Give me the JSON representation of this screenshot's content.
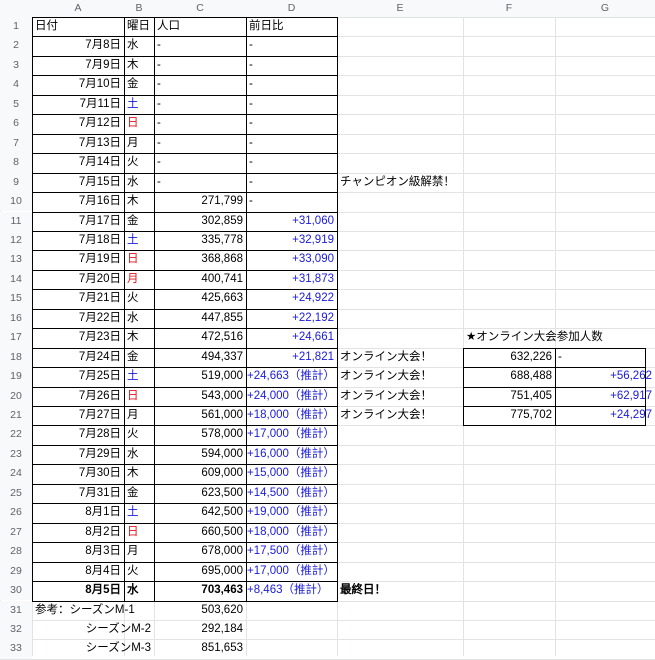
{
  "columns": [
    "A",
    "B",
    "C",
    "D",
    "E",
    "F",
    "G"
  ],
  "row_numbers": [
    "1",
    "2",
    "3",
    "4",
    "5",
    "6",
    "7",
    "8",
    "9",
    "10",
    "11",
    "12",
    "13",
    "14",
    "15",
    "16",
    "17",
    "18",
    "19",
    "20",
    "21",
    "22",
    "23",
    "24",
    "25",
    "26",
    "27",
    "28",
    "29",
    "30",
    "31",
    "32",
    "33"
  ],
  "header": {
    "date": "日付",
    "weekday": "曜日",
    "population": "人口",
    "prev_day": "前日比"
  },
  "rows": [
    {
      "date": "7月8日",
      "wd": "水",
      "wdc": "k",
      "pop": "-",
      "diff": "-"
    },
    {
      "date": "7月9日",
      "wd": "木",
      "wdc": "k",
      "pop": "-",
      "diff": "-"
    },
    {
      "date": "7月10日",
      "wd": "金",
      "wdc": "k",
      "pop": "-",
      "diff": "-"
    },
    {
      "date": "7月11日",
      "wd": "土",
      "wdc": "b",
      "pop": "-",
      "diff": "-"
    },
    {
      "date": "7月12日",
      "wd": "日",
      "wdc": "r",
      "pop": "-",
      "diff": "-"
    },
    {
      "date": "7月13日",
      "wd": "月",
      "wdc": "k",
      "pop": "-",
      "diff": "-"
    },
    {
      "date": "7月14日",
      "wd": "火",
      "wdc": "k",
      "pop": "-",
      "diff": "-"
    },
    {
      "date": "7月15日",
      "wd": "水",
      "wdc": "k",
      "pop": "-",
      "diff": "-",
      "note": "チャンピオン級解禁！"
    },
    {
      "date": "7月16日",
      "wd": "木",
      "wdc": "k",
      "pop": "271,799",
      "diff": "-"
    },
    {
      "date": "7月17日",
      "wd": "金",
      "wdc": "k",
      "pop": "302,859",
      "diff": "+31,060"
    },
    {
      "date": "7月18日",
      "wd": "土",
      "wdc": "b",
      "pop": "335,778",
      "diff": "+32,919"
    },
    {
      "date": "7月19日",
      "wd": "日",
      "wdc": "r",
      "pop": "368,868",
      "diff": "+33,090"
    },
    {
      "date": "7月20日",
      "wd": "月",
      "wdc": "r",
      "pop": "400,741",
      "diff": "+31,873"
    },
    {
      "date": "7月21日",
      "wd": "火",
      "wdc": "k",
      "pop": "425,663",
      "diff": "+24,922"
    },
    {
      "date": "7月22日",
      "wd": "水",
      "wdc": "k",
      "pop": "447,855",
      "diff": "+22,192"
    },
    {
      "date": "7月23日",
      "wd": "木",
      "wdc": "k",
      "pop": "472,516",
      "diff": "+24,661"
    },
    {
      "date": "7月24日",
      "wd": "金",
      "wdc": "k",
      "pop": "494,337",
      "diff": "+21,821",
      "note": "オンライン大会！"
    },
    {
      "date": "7月25日",
      "wd": "土",
      "wdc": "b",
      "pop": "519,000",
      "diff": "+24,663（推計）",
      "note": "オンライン大会！"
    },
    {
      "date": "7月26日",
      "wd": "日",
      "wdc": "r",
      "pop": "543,000",
      "diff": "+24,000（推計）",
      "note": "オンライン大会！"
    },
    {
      "date": "7月27日",
      "wd": "月",
      "wdc": "k",
      "pop": "561,000",
      "diff": "+18,000（推計）",
      "note": "オンライン大会！"
    },
    {
      "date": "7月28日",
      "wd": "火",
      "wdc": "k",
      "pop": "578,000",
      "diff": "+17,000（推計）"
    },
    {
      "date": "7月29日",
      "wd": "水",
      "wdc": "k",
      "pop": "594,000",
      "diff": "+16,000（推計）"
    },
    {
      "date": "7月30日",
      "wd": "木",
      "wdc": "k",
      "pop": "609,000",
      "diff": "+15,000（推計）"
    },
    {
      "date": "7月31日",
      "wd": "金",
      "wdc": "k",
      "pop": "623,500",
      "diff": "+14,500（推計）"
    },
    {
      "date": "8月1日",
      "wd": "土",
      "wdc": "b",
      "pop": "642,500",
      "diff": "+19,000（推計）"
    },
    {
      "date": "8月2日",
      "wd": "日",
      "wdc": "r",
      "pop": "660,500",
      "diff": "+18,000（推計）"
    },
    {
      "date": "8月3日",
      "wd": "月",
      "wdc": "k",
      "pop": "678,000",
      "diff": "+17,500（推計）"
    },
    {
      "date": "8月4日",
      "wd": "火",
      "wdc": "k",
      "pop": "695,000",
      "diff": "+17,000（推計）"
    },
    {
      "date": "8月5日",
      "wd": "水",
      "wdc": "k",
      "pop": "703,463",
      "diff": "+8,463（推計）",
      "note": "最終日！",
      "bold": true
    }
  ],
  "reference": [
    {
      "label": "参考：シーズンM-1",
      "value": "503,620"
    },
    {
      "label": "シーズンM-2",
      "value": "292,184"
    },
    {
      "label": "シーズンM-3",
      "value": "851,653"
    }
  ],
  "online": {
    "title": "★オンライン大会参加人数",
    "rows": [
      {
        "count": "632,226",
        "diff": "-"
      },
      {
        "count": "688,488",
        "diff": "+56,262"
      },
      {
        "count": "751,405",
        "diff": "+62,917"
      },
      {
        "count": "775,702",
        "diff": "+24,297"
      }
    ]
  },
  "colors": {
    "blue": "#1a1adb",
    "red": "#e0161b",
    "grid": "#e2e3e3",
    "header_bg": "#f8f9fa"
  }
}
